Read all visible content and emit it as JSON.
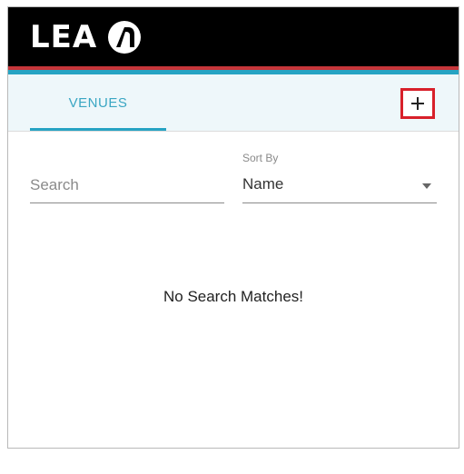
{
  "header": {
    "logo_text": "LEA",
    "logo_icon": "lea-mark-icon",
    "colors": {
      "background": "#000000",
      "stripe_red": "#c6363a",
      "stripe_teal": "#26a3c3"
    }
  },
  "tabs": [
    {
      "label": "VENUES",
      "active": true
    }
  ],
  "toolbar": {
    "add_icon": "plus-icon",
    "add_highlight_color": "#d8202a"
  },
  "search": {
    "placeholder": "Search",
    "value": ""
  },
  "sort": {
    "label": "Sort By",
    "selected": "Name",
    "caret_icon": "caret-down-icon"
  },
  "results": {
    "empty_message": "No Search Matches!"
  }
}
